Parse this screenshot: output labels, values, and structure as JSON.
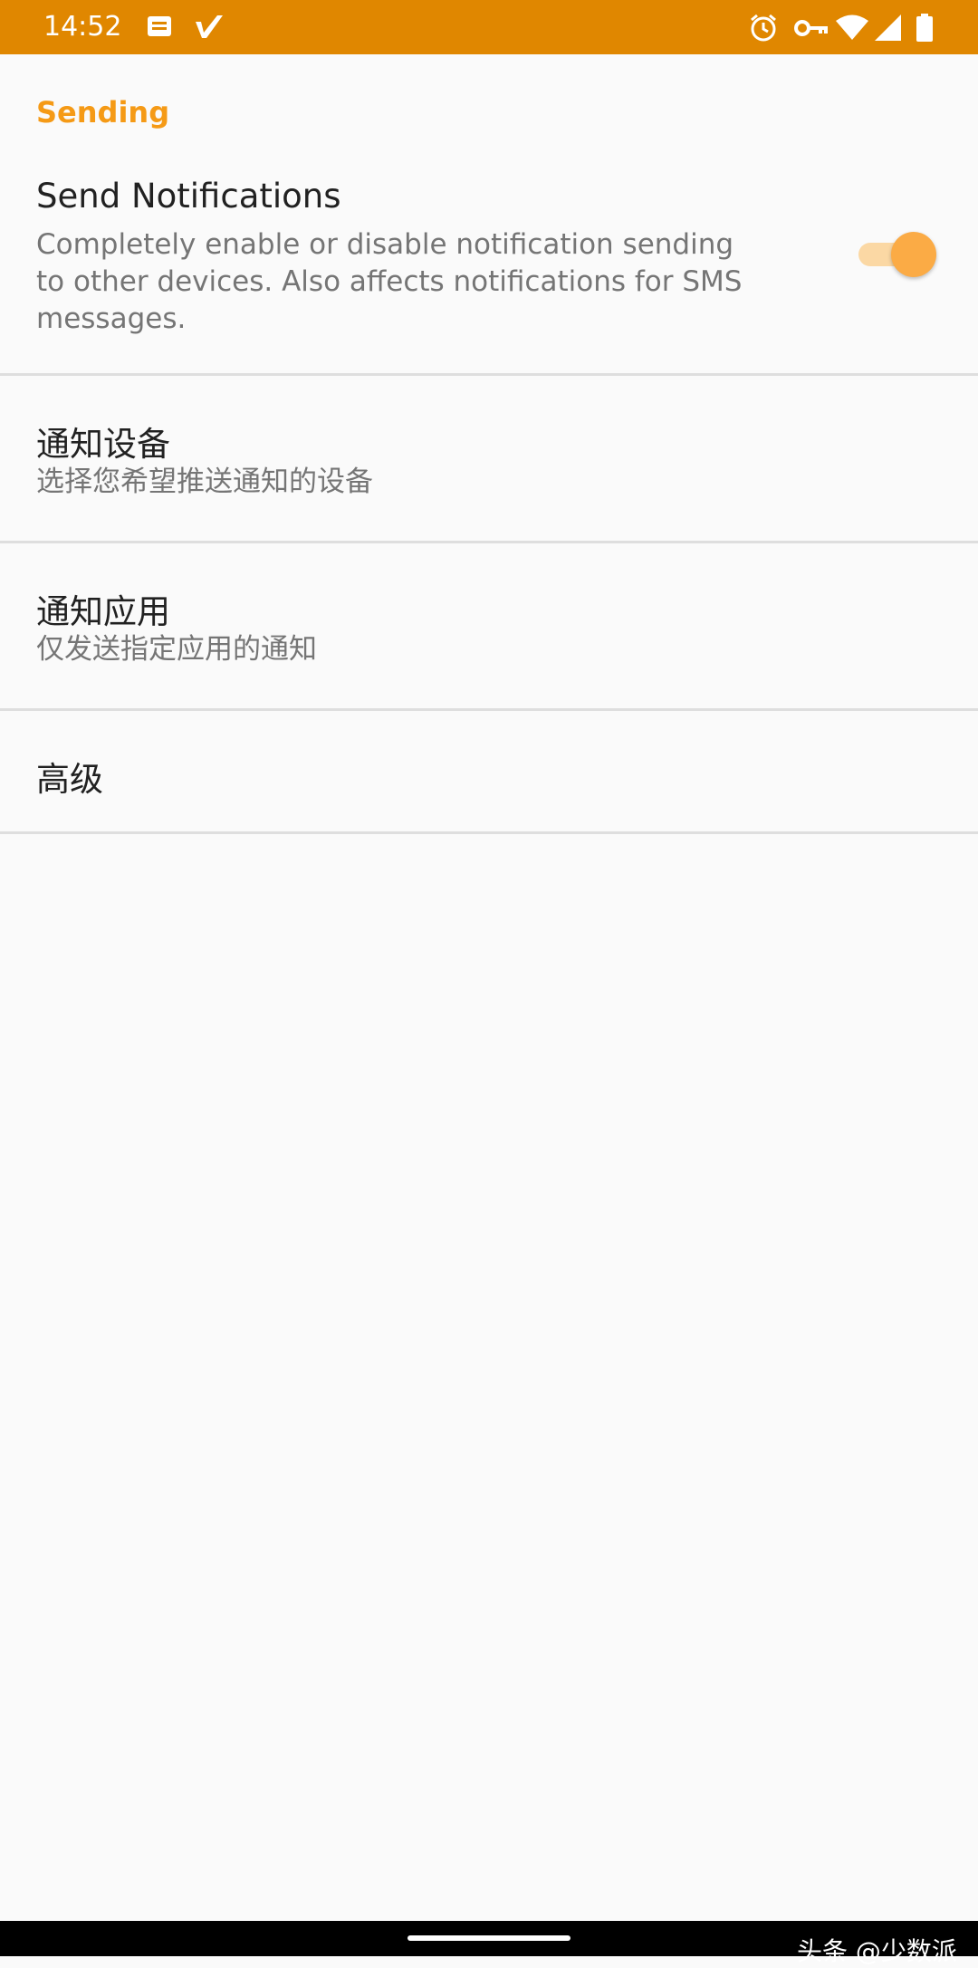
{
  "status_bar": {
    "time": "14:52",
    "left_icons": [
      "message-icon",
      "check-app-icon"
    ],
    "right_icons": [
      "alarm-icon",
      "vpn-key-icon",
      "wifi-icon",
      "signal-icon",
      "battery-icon"
    ],
    "background": "#e08700"
  },
  "sections": [
    {
      "header": "Sending"
    }
  ],
  "preferences": [
    {
      "title": "Send Notifications",
      "summary_lines": [
        "Completely enable or disable notification sending",
        "to other devices. Also affects notifications for SMS",
        "messages."
      ],
      "switch_on": true
    },
    {
      "title": "通知设备",
      "summary": "选择您希望推送通知的设备"
    },
    {
      "title": "通知应用",
      "summary": "仅发送指定应用的通知"
    },
    {
      "title": "高级"
    }
  ],
  "watermark": "头条 @少数派",
  "colors": {
    "accent": "#f59a16",
    "switch_thumb": "#fbab45",
    "switch_track": "#fbd8a4"
  }
}
